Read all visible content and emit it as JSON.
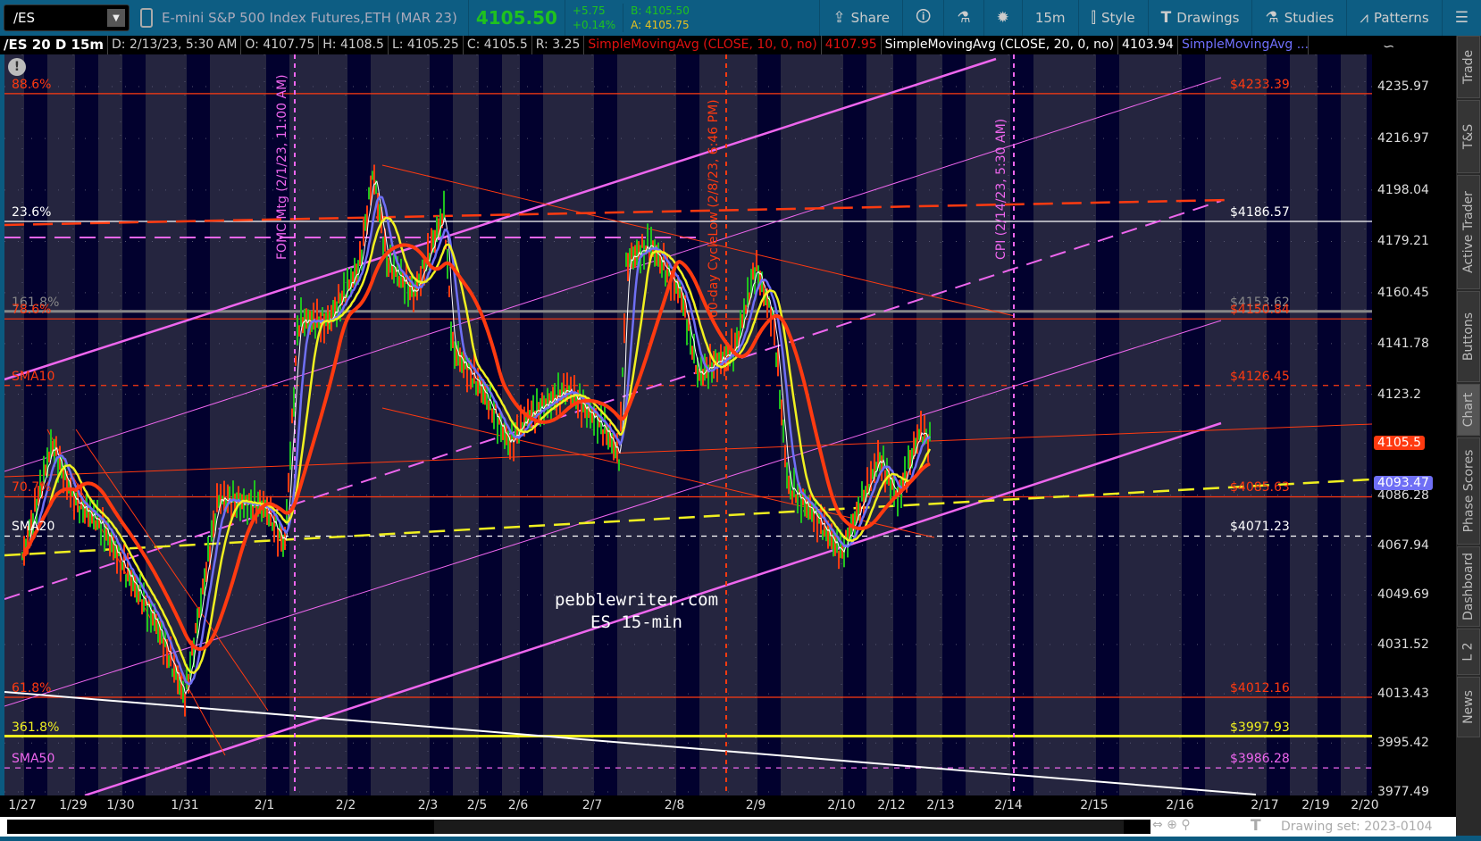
{
  "toolbar": {
    "symbol": "/ES",
    "description": "E-mini S&P 500 Index Futures,ETH (MAR 23)",
    "last": "4105.50",
    "change": "+5.75",
    "change_pct": "+0.14%",
    "bid": "B: 4105.50",
    "ask": "A: 4105.75",
    "buttons": [
      {
        "label": "Share",
        "icon": "share-icon"
      },
      {
        "label": "",
        "icon": "info-card-icon"
      },
      {
        "label": "",
        "icon": "flask-icon"
      },
      {
        "label": "",
        "icon": "gear-icon"
      },
      {
        "label": "15m",
        "icon": ""
      },
      {
        "label": "Style",
        "icon": "candle-icon"
      },
      {
        "label": "Drawings",
        "icon": "text-t-icon"
      },
      {
        "label": "Studies",
        "icon": "flask-icon"
      },
      {
        "label": "Patterns",
        "icon": "pattern-icon"
      },
      {
        "label": "",
        "icon": "menu-list-icon"
      }
    ]
  },
  "infobar": {
    "symbol": "/ES 20 D 15m",
    "date": "D: 2/13/23, 5:30 AM",
    "open": "O: 4107.75",
    "high": "H: 4108.5",
    "low": "L: 4105.25",
    "close": "C: 4105.5",
    "range": "R: 3.25",
    "sma10": "SimpleMovingAvg (CLOSE, 10, 0, no)",
    "sma10_val": "4107.95",
    "sma20": "SimpleMovingAvg (CLOSE, 20, 0, no)",
    "sma20_val": "4103.94",
    "sma3": "SimpleMovingAvg ..."
  },
  "chart_data": {
    "type": "line",
    "price_axis": {
      "ticks": [
        "4235.97",
        "4216.97",
        "4198.04",
        "4179.21",
        "4160.45",
        "4141.78",
        "4123.2",
        "4086.28",
        "4067.94",
        "4049.69",
        "4031.52",
        "4013.43",
        "3995.42",
        "3977.49"
      ],
      "range": [
        3977.49,
        4235.97
      ]
    },
    "date_ticks": [
      "1/27",
      "1/29",
      "1/30",
      "1/31",
      "2/1",
      "2/2",
      "2/3",
      "2/5",
      "2/6",
      "2/7",
      "2/8",
      "2/9",
      "2/10",
      "2/12",
      "2/13",
      "2/14",
      "2/15",
      "2/16",
      "2/17",
      "2/19",
      "2/20"
    ],
    "price_path": [
      [
        "1/27 00:00",
        4063
      ],
      [
        "1/27 14:00",
        4105
      ],
      [
        "1/29 00:00",
        4085
      ],
      [
        "1/29 15:00",
        4075
      ],
      [
        "1/30 00:00",
        4062
      ],
      [
        "1/30 13:00",
        4040
      ],
      [
        "1/31 00:00",
        4012
      ],
      [
        "1/31 10:00",
        4085
      ],
      [
        "2/1 00:00",
        4082
      ],
      [
        "2/1 06:00",
        4068
      ],
      [
        "2/1 10:00",
        4150
      ],
      [
        "2/1 19:00",
        4150
      ],
      [
        "2/2 04:00",
        4170
      ],
      [
        "2/2 08:00",
        4205
      ],
      [
        "2/2 12:00",
        4172
      ],
      [
        "2/2 20:00",
        4160
      ],
      [
        "2/3 08:00",
        4190
      ],
      [
        "2/3 12:00",
        4140
      ],
      [
        "2/5 03:00",
        4125
      ],
      [
        "2/5 19:00",
        4105
      ],
      [
        "2/6 03:00",
        4115
      ],
      [
        "2/6 16:00",
        4125
      ],
      [
        "2/7 04:00",
        4110
      ],
      [
        "2/7 08:00",
        4100
      ],
      [
        "2/7 10:00",
        4172
      ],
      [
        "2/7 17:00",
        4178
      ],
      [
        "2/8 02:00",
        4160
      ],
      [
        "2/8 07:00",
        4130
      ],
      [
        "2/8 18:00",
        4140
      ],
      [
        "2/9 00:00",
        4170
      ],
      [
        "2/9 05:00",
        4150
      ],
      [
        "2/9 09:00",
        4090
      ],
      [
        "2/9 16:00",
        4080
      ],
      [
        "2/10 00:00",
        4065
      ],
      [
        "2/10 09:00",
        4082
      ],
      [
        "2/10 18:00",
        4100
      ],
      [
        "2/12 03:00",
        4085
      ],
      [
        "2/12 14:00",
        4110
      ],
      [
        "2/12 19:00",
        4105.5
      ]
    ],
    "studies": [
      {
        "name": "SMA10",
        "color": "#ffffff"
      },
      {
        "name": "SMA20",
        "color": "#6f6ff5"
      },
      {
        "name": "SMA50",
        "color": "#f0f020"
      },
      {
        "name": "SMA",
        "color": "#ff3a10"
      }
    ],
    "levels": [
      {
        "label": "88.6%",
        "price": 4233.39,
        "price_label": "$4233.39",
        "color": "#ff3a10",
        "style": "solid"
      },
      {
        "label": "23.6%",
        "price": 4186.57,
        "price_label": "$4186.57",
        "color": "#ffffff",
        "style": "solid"
      },
      {
        "label": "161.8%",
        "price": 4153.62,
        "price_label": "$4153.62",
        "color": "#888888",
        "style": "thick"
      },
      {
        "label": "78.6%",
        "price": 4150.84,
        "price_label": "$4150.84",
        "color": "#ff3a10",
        "style": "solid"
      },
      {
        "label": "SMA10",
        "price": 4126.45,
        "price_label": "$4126.45",
        "color": "#ff3a10",
        "style": "dashed"
      },
      {
        "label": "70.7%",
        "price": 4085.63,
        "price_label": "$4085.63",
        "color": "#ff3a10",
        "style": "solid"
      },
      {
        "label": "SMA20",
        "price": 4071.23,
        "price_label": "$4071.23",
        "color": "#ffffff",
        "style": "dashed"
      },
      {
        "label": "61.8%",
        "price": 4012.16,
        "price_label": "$4012.16",
        "color": "#ff3a10",
        "style": "solid"
      },
      {
        "label": "361.8%",
        "price": 3997.93,
        "price_label": "$3997.93",
        "color": "#f0f020",
        "style": "thick"
      },
      {
        "label": "SMA50",
        "price": 3986.28,
        "price_label": "$3986.28",
        "color": "#ee66ee",
        "style": "dashed"
      }
    ],
    "events": [
      {
        "label": "FOMC Mtg (2/1/23, 11:00 AM)",
        "color": "#ee66ee"
      },
      {
        "label": "60-day CycleLow (2/8/23, 6:46 PM)",
        "color": "#ff3a10"
      },
      {
        "label": "CPI (2/14/23, 5:30 AM)",
        "color": "#ee66ee"
      }
    ],
    "badges": [
      {
        "value": "4105.5",
        "price": 4105.5,
        "color": "#ff3a10"
      },
      {
        "value": "4093.47",
        "price": 4093.47,
        "color": "#6f6ff5"
      }
    ],
    "watermark": [
      "pebblewriter.com",
      "ES 15-min"
    ]
  },
  "sidebar": [
    "Trade",
    "T&S",
    "Active Trader",
    "Buttons",
    "Chart",
    "Phase Scores",
    "Dashboard",
    "L 2",
    "News"
  ],
  "footer": {
    "drawing_set": "Drawing set: 2023-0104"
  }
}
